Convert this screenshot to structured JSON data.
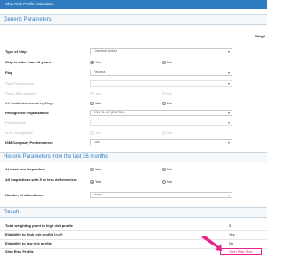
{
  "window": {
    "title": "Ship Risk Profile Calculator"
  },
  "sections": {
    "generic": "Generic Parameters",
    "historic": "Historic Parameters from the last 36 months",
    "result": "Result"
  },
  "weigh_header": "Weigh",
  "generic": {
    "type_of_ship": {
      "label": "Type of Ship",
      "value": "Chemical tanker"
    },
    "older_than_13": {
      "label": "Ship is older than 13 years:",
      "yes": "Yes",
      "no": "No"
    },
    "flag": {
      "label": "Flag",
      "value": "Panama"
    },
    "flag_performance": {
      "label": "Flag Performance",
      "value": ""
    },
    "flags_imo_audit": {
      "label": "Flag's IMO audited:",
      "yes": "Yes",
      "no": "No"
    },
    "all_certificates": {
      "label": "All Certificates issued by Flag :",
      "yes": "Yes",
      "no": "No"
    },
    "recognized_org": {
      "label": "Recognized Organization:",
      "value": "DNV GL AS (DNVGL)"
    },
    "ro_performance": {
      "label": "Performance",
      "value": ""
    },
    "eu_ro": {
      "label": "Is EU recognized:",
      "yes": "Yes",
      "no": "No"
    },
    "ism_performance": {
      "label": "ISM Company Performance:",
      "value": "Low"
    }
  },
  "historic": {
    "inspection": {
      "label": "At least one inspection:",
      "yes": "Yes",
      "no": "No"
    },
    "deficiencies": {
      "label": "All inspections with 5 or less deficiencies:",
      "yes": "Yes",
      "no": "No"
    },
    "detentions": {
      "label": "Number of detentions:",
      "value": "None"
    }
  },
  "result": {
    "total_weighting": {
      "label": "Total weighting point to high risk profile",
      "value": "5"
    },
    "eligibility_high": {
      "label": "Eligibility to high risk profile (>=5)",
      "value": "Yes"
    },
    "eligibility_low": {
      "label": "Eligibility to low risk profile",
      "value": "No"
    },
    "profile": {
      "label": "Ship Risk Profile",
      "value": "High Risk Ship"
    }
  },
  "colors": {
    "accent": "#2f7bbf",
    "highlight": "#e8228a"
  }
}
